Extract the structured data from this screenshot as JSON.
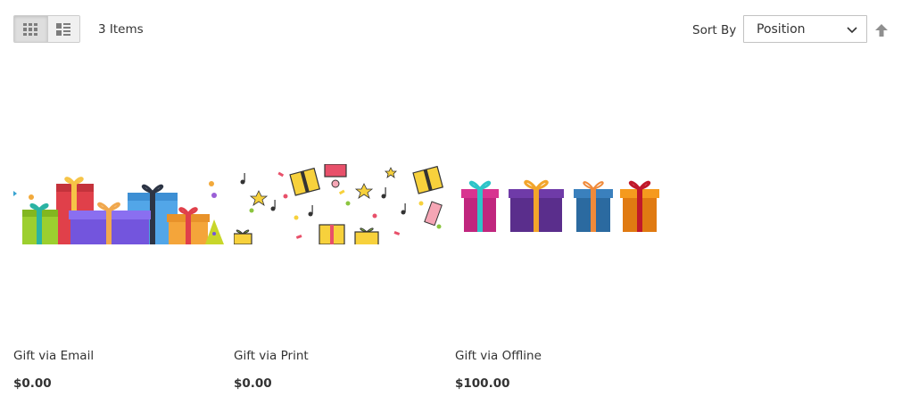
{
  "toolbar": {
    "view_modes": [
      {
        "name": "grid",
        "icon": "grid-icon",
        "active": true
      },
      {
        "name": "list",
        "icon": "list-icon",
        "active": false
      }
    ],
    "item_count": "3 Items",
    "sort_label": "Sort By",
    "sort_selected": "Position",
    "sort_direction_icon": "arrow-up-icon"
  },
  "products": [
    {
      "name": "Gift via Email",
      "price": "$0.00",
      "image": "gift-boxes-illustration"
    },
    {
      "name": "Gift via Print",
      "price": "$0.00",
      "image": "gift-confetti-pattern"
    },
    {
      "name": "Gift via Offline",
      "price": "$100.00",
      "image": "four-gift-boxes"
    }
  ],
  "colors": {
    "text": "#333333",
    "border": "#cccccc",
    "mode_bg": "#f0f0f0",
    "sort_arrow": "#8f8f8f"
  }
}
